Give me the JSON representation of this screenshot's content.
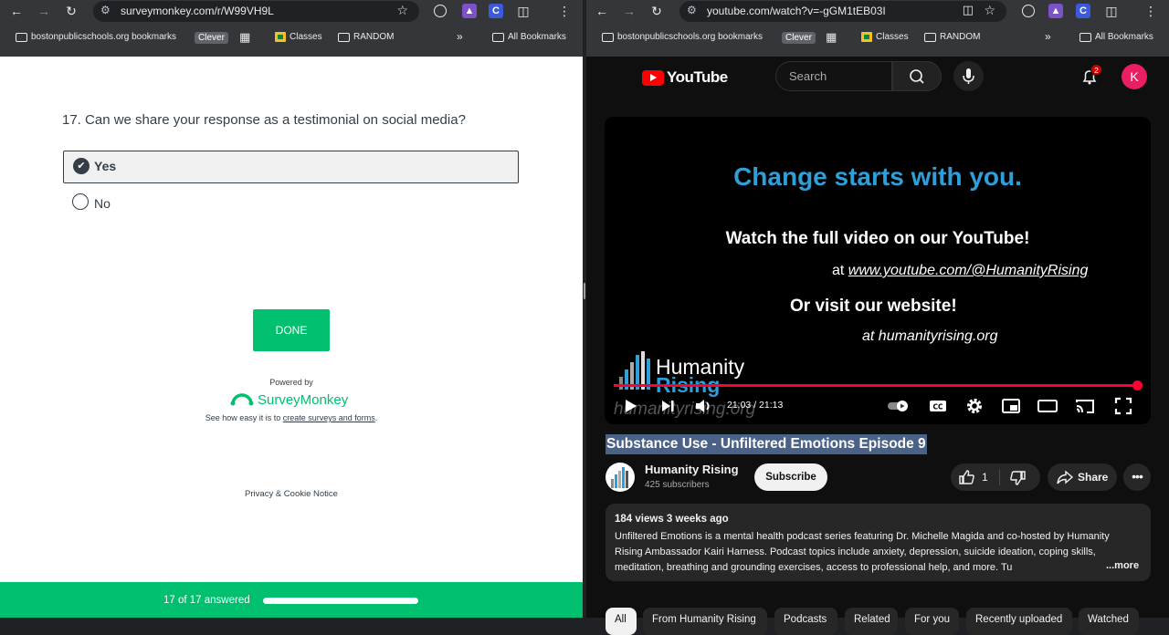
{
  "left_browser": {
    "url": "surveymonkey.com/r/W99VH9L",
    "bookmarks": {
      "folder1": "bostonpublicschools.org bookmarks",
      "clever": "Clever",
      "classes": "Classes",
      "random": "RANDOM",
      "all": "All Bookmarks"
    }
  },
  "right_browser": {
    "url": "youtube.com/watch?v=-gGM1tEB03I",
    "bookmarks": {
      "folder1": "bostonpublicschools.org bookmarks",
      "clever": "Clever",
      "classes": "Classes",
      "random": "RANDOM",
      "all": "All Bookmarks"
    }
  },
  "survey": {
    "question": "17. Can we share your response as a testimonial on social media?",
    "options": [
      {
        "label": "Yes",
        "selected": true
      },
      {
        "label": "No",
        "selected": false
      }
    ],
    "done_label": "DONE",
    "powered_by": "Powered by",
    "brand": "SurveyMonkey",
    "tagline_prefix": "See how easy it is to ",
    "tagline_link": "create surveys and forms",
    "tagline_suffix": ".",
    "privacy": "Privacy & Cookie Notice",
    "progress_text": "17 of 17 answered",
    "progress_fraction": 1.0,
    "accent_color": "#00bf6f"
  },
  "youtube": {
    "logo_text": "YouTube",
    "search_placeholder": "Search",
    "notifications": "2",
    "avatar_letter": "K",
    "video": {
      "headline": "Change starts with you.",
      "line1": "Watch the full video on our YouTube!",
      "line2_prefix": "at ",
      "line2_link": "www.youtube.com/@HumanityRising",
      "line3": "Or visit our website!",
      "line4": "at humanityrising.org",
      "logo_line1": "Humanity",
      "logo_line2": "Rising",
      "watermark": "humanityrising.org",
      "time": "21:03 / 21:13",
      "progress_fraction": 0.992
    },
    "title": "Substance Use - Unfiltered Emotions Episode 9",
    "channel": "Humanity Rising",
    "subscribers": "425 subscribers",
    "subscribe_label": "Subscribe",
    "likes": "1",
    "share_label": "Share",
    "description": {
      "meta": "184 views  3 weeks ago",
      "text": "Unfiltered Emotions is a mental health podcast series featuring Dr. Michelle Magida and co-hosted by Humanity Rising Ambassador Kairi Harness. Podcast topics include anxiety, depression, suicide ideation, coping skills, meditation, breathing and grounding exercises, access to professional help, and more. Tu",
      "more": "...more"
    },
    "chips": [
      "All",
      "From Humanity Rising",
      "Podcasts",
      "Related",
      "For you",
      "Recently uploaded",
      "Watched"
    ]
  }
}
